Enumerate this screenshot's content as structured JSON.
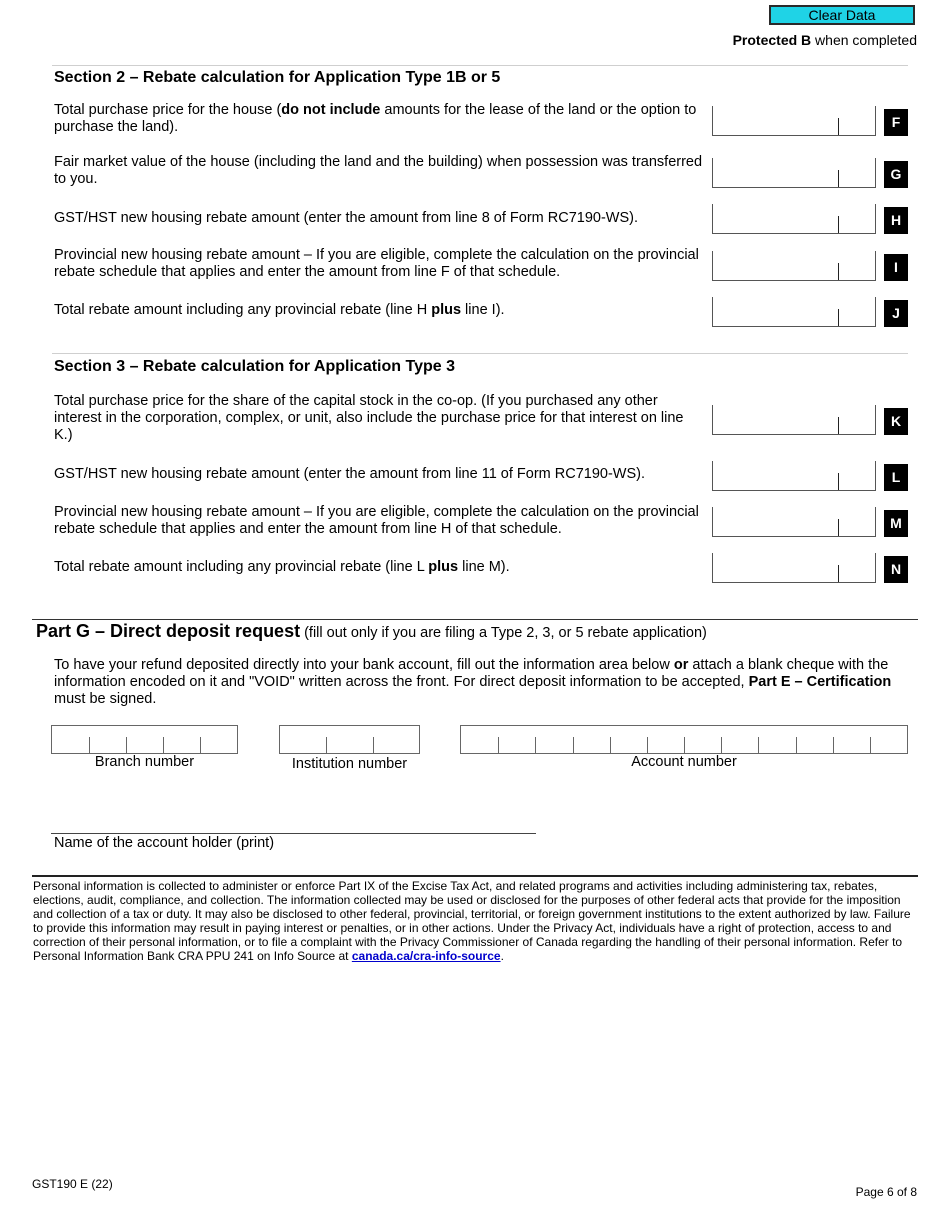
{
  "header": {
    "clear_button": "Clear Data",
    "protected_bold": "Protected B",
    "protected_rest": " when completed",
    "colors": {
      "clear_button_bg": "#1fd3e6"
    }
  },
  "section2": {
    "title": "Section 2 – Rebate calculation for Application Type 1B or 5",
    "lines": [
      {
        "letter": "F",
        "pre": "Total purchase price for the house (",
        "bold": "do not include",
        "post": " amounts for the lease of the land or the option to purchase the land).",
        "value": ""
      },
      {
        "letter": "G",
        "pre": "Fair market value of the house (including the land and the building) when possession was transferred to you.",
        "bold": "",
        "post": "",
        "value": ""
      },
      {
        "letter": "H",
        "pre": "GST/HST new housing rebate amount (enter the amount from line 8 of Form RC7190-WS).",
        "bold": "",
        "post": "",
        "value": ""
      },
      {
        "letter": "I",
        "pre": "Provincial new housing rebate amount – If you are eligible, complete the calculation on the provincial rebate schedule that applies and enter the amount from line F of that schedule.",
        "bold": "",
        "post": "",
        "value": ""
      },
      {
        "letter": "J",
        "pre": "Total rebate amount including any provincial rebate (line H ",
        "bold": "plus",
        "post": " line I).",
        "value": ""
      }
    ]
  },
  "section3": {
    "title": "Section 3 – Rebate calculation for Application Type 3",
    "lines": [
      {
        "letter": "K",
        "pre": "Total purchase price for the share of the capital stock in the co-op. (If you purchased any other interest in the corporation, complex, or unit, also include the purchase price for that interest on line K.)",
        "bold": "",
        "post": "",
        "value": ""
      },
      {
        "letter": "L",
        "pre": "GST/HST new housing rebate amount (enter the amount from line 11 of Form RC7190-WS).",
        "bold": "",
        "post": "",
        "value": ""
      },
      {
        "letter": "M",
        "pre": "Provincial new housing rebate amount – If you are eligible, complete the calculation on the provincial rebate schedule that applies and enter the amount from line H of that schedule.",
        "bold": "",
        "post": "",
        "value": ""
      },
      {
        "letter": "N",
        "pre": "Total rebate amount including any provincial rebate (line L ",
        "bold": "plus",
        "post": " line M).",
        "value": ""
      }
    ]
  },
  "partG": {
    "title": "Part G – Direct deposit request",
    "subtitle": " (fill out only if you are filing a Type 2, 3, or 5 rebate application)",
    "instr_1": "To have your refund deposited directly into your bank account, fill out the information area below ",
    "instr_bold_or": "or",
    "instr_2": " attach a blank cheque with the information encoded on it and \"VOID\" written across the front. For direct deposit information to be accepted, ",
    "instr_bold_cert": "Part E – Certification",
    "instr_3": " must be signed.",
    "branch_label": "Branch number",
    "branch_cells": 5,
    "institution_label": "Institution number",
    "institution_cells": 3,
    "account_label": "Account number",
    "account_cells": 12,
    "holder_label": "Name of the account holder (print)",
    "holder_value": ""
  },
  "privacy": {
    "text": "Personal information is collected to administer or enforce Part IX of the Excise Tax Act, and related programs and activities including administering tax, rebates, elections, audit, compliance, and collection. The information collected may be used or disclosed for the purposes of other federal acts that provide for the imposition and collection of a tax or duty. It may also be disclosed to other federal, provincial, territorial, or foreign government institutions to the extent authorized by law. Failure to provide this information may result in paying interest or penalties, or in other actions. Under the Privacy Act, individuals have a right of protection, access to and correction of their personal information, or to file a complaint with the Privacy Commissioner of Canada regarding the handling of their personal information. Refer to Personal Information Bank CRA PPU 241 on Info Source at ",
    "link": "canada.ca/cra-info-source",
    "end": "."
  },
  "footer": {
    "form_id": "GST190 E (22)",
    "page": "Page 6 of 8"
  }
}
